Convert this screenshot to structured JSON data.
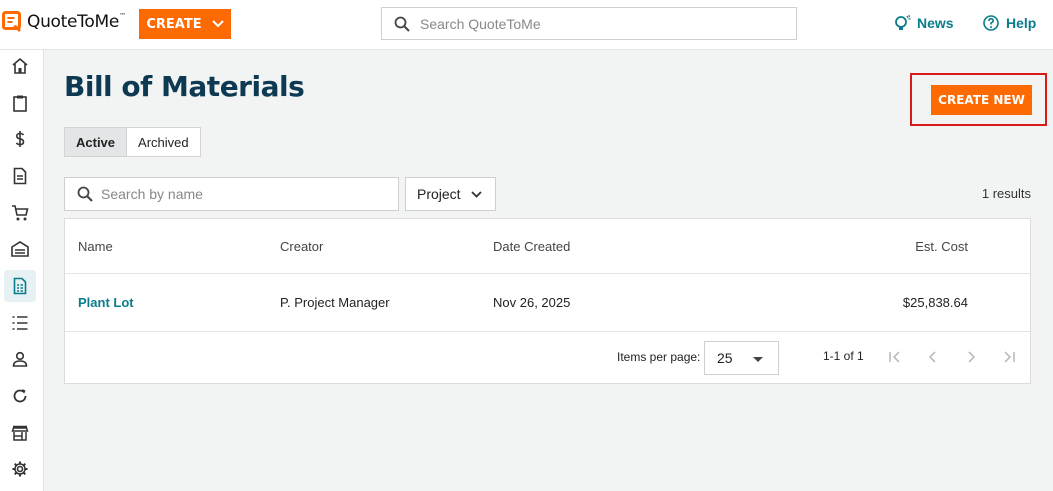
{
  "header": {
    "logo_text": "QuoteToMe",
    "logo_tm": "™",
    "create_label": "CREATE",
    "search_placeholder": "Search QuoteToMe",
    "news_label": "News",
    "help_label": "Help"
  },
  "sidebar": {
    "items": [
      {
        "icon": "home-icon"
      },
      {
        "icon": "clipboard-icon"
      },
      {
        "icon": "dollar-icon"
      },
      {
        "icon": "document-icon"
      },
      {
        "icon": "cart-icon"
      },
      {
        "icon": "warehouse-icon"
      },
      {
        "icon": "bill-of-materials-icon",
        "active": true
      },
      {
        "icon": "list-icon"
      },
      {
        "icon": "person-icon"
      },
      {
        "icon": "refresh-icon"
      },
      {
        "icon": "store-icon"
      },
      {
        "icon": "gear-icon"
      }
    ]
  },
  "page": {
    "title": "Bill of Materials",
    "create_new_label": "CREATE NEW",
    "tabs": [
      {
        "label": "Active",
        "active": true
      },
      {
        "label": "Archived",
        "active": false
      }
    ],
    "name_search_placeholder": "Search by name",
    "project_filter_label": "Project",
    "results_text": "1 results"
  },
  "table": {
    "columns": [
      "Name",
      "Creator",
      "Date Created",
      "Est. Cost"
    ],
    "rows": [
      {
        "name": "Plant Lot",
        "creator": "P. Project Manager",
        "date_created": "Nov 26, 2025",
        "est_cost": "$25,838.64"
      }
    ],
    "pagination": {
      "items_per_page_label": "Items per page:",
      "items_per_page_value": "25",
      "range_text": "1-1 of 1"
    }
  },
  "colors": {
    "accent_orange": "#fd6a02",
    "title_navy": "#0d3a52",
    "link_teal": "#0a7d8c",
    "highlight_red": "#d71a1a"
  }
}
